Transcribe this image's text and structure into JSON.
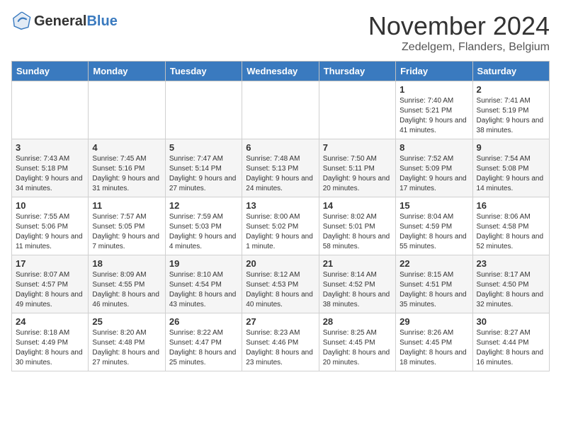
{
  "logo": {
    "text_general": "General",
    "text_blue": "Blue"
  },
  "title": {
    "month_year": "November 2024",
    "location": "Zedelgem, Flanders, Belgium"
  },
  "columns": [
    "Sunday",
    "Monday",
    "Tuesday",
    "Wednesday",
    "Thursday",
    "Friday",
    "Saturday"
  ],
  "weeks": [
    [
      {
        "day": "",
        "sunrise": "",
        "sunset": "",
        "daylight": ""
      },
      {
        "day": "",
        "sunrise": "",
        "sunset": "",
        "daylight": ""
      },
      {
        "day": "",
        "sunrise": "",
        "sunset": "",
        "daylight": ""
      },
      {
        "day": "",
        "sunrise": "",
        "sunset": "",
        "daylight": ""
      },
      {
        "day": "",
        "sunrise": "",
        "sunset": "",
        "daylight": ""
      },
      {
        "day": "1",
        "sunrise": "Sunrise: 7:40 AM",
        "sunset": "Sunset: 5:21 PM",
        "daylight": "Daylight: 9 hours and 41 minutes."
      },
      {
        "day": "2",
        "sunrise": "Sunrise: 7:41 AM",
        "sunset": "Sunset: 5:19 PM",
        "daylight": "Daylight: 9 hours and 38 minutes."
      }
    ],
    [
      {
        "day": "3",
        "sunrise": "Sunrise: 7:43 AM",
        "sunset": "Sunset: 5:18 PM",
        "daylight": "Daylight: 9 hours and 34 minutes."
      },
      {
        "day": "4",
        "sunrise": "Sunrise: 7:45 AM",
        "sunset": "Sunset: 5:16 PM",
        "daylight": "Daylight: 9 hours and 31 minutes."
      },
      {
        "day": "5",
        "sunrise": "Sunrise: 7:47 AM",
        "sunset": "Sunset: 5:14 PM",
        "daylight": "Daylight: 9 hours and 27 minutes."
      },
      {
        "day": "6",
        "sunrise": "Sunrise: 7:48 AM",
        "sunset": "Sunset: 5:13 PM",
        "daylight": "Daylight: 9 hours and 24 minutes."
      },
      {
        "day": "7",
        "sunrise": "Sunrise: 7:50 AM",
        "sunset": "Sunset: 5:11 PM",
        "daylight": "Daylight: 9 hours and 20 minutes."
      },
      {
        "day": "8",
        "sunrise": "Sunrise: 7:52 AM",
        "sunset": "Sunset: 5:09 PM",
        "daylight": "Daylight: 9 hours and 17 minutes."
      },
      {
        "day": "9",
        "sunrise": "Sunrise: 7:54 AM",
        "sunset": "Sunset: 5:08 PM",
        "daylight": "Daylight: 9 hours and 14 minutes."
      }
    ],
    [
      {
        "day": "10",
        "sunrise": "Sunrise: 7:55 AM",
        "sunset": "Sunset: 5:06 PM",
        "daylight": "Daylight: 9 hours and 11 minutes."
      },
      {
        "day": "11",
        "sunrise": "Sunrise: 7:57 AM",
        "sunset": "Sunset: 5:05 PM",
        "daylight": "Daylight: 9 hours and 7 minutes."
      },
      {
        "day": "12",
        "sunrise": "Sunrise: 7:59 AM",
        "sunset": "Sunset: 5:03 PM",
        "daylight": "Daylight: 9 hours and 4 minutes."
      },
      {
        "day": "13",
        "sunrise": "Sunrise: 8:00 AM",
        "sunset": "Sunset: 5:02 PM",
        "daylight": "Daylight: 9 hours and 1 minute."
      },
      {
        "day": "14",
        "sunrise": "Sunrise: 8:02 AM",
        "sunset": "Sunset: 5:01 PM",
        "daylight": "Daylight: 8 hours and 58 minutes."
      },
      {
        "day": "15",
        "sunrise": "Sunrise: 8:04 AM",
        "sunset": "Sunset: 4:59 PM",
        "daylight": "Daylight: 8 hours and 55 minutes."
      },
      {
        "day": "16",
        "sunrise": "Sunrise: 8:06 AM",
        "sunset": "Sunset: 4:58 PM",
        "daylight": "Daylight: 8 hours and 52 minutes."
      }
    ],
    [
      {
        "day": "17",
        "sunrise": "Sunrise: 8:07 AM",
        "sunset": "Sunset: 4:57 PM",
        "daylight": "Daylight: 8 hours and 49 minutes."
      },
      {
        "day": "18",
        "sunrise": "Sunrise: 8:09 AM",
        "sunset": "Sunset: 4:55 PM",
        "daylight": "Daylight: 8 hours and 46 minutes."
      },
      {
        "day": "19",
        "sunrise": "Sunrise: 8:10 AM",
        "sunset": "Sunset: 4:54 PM",
        "daylight": "Daylight: 8 hours and 43 minutes."
      },
      {
        "day": "20",
        "sunrise": "Sunrise: 8:12 AM",
        "sunset": "Sunset: 4:53 PM",
        "daylight": "Daylight: 8 hours and 40 minutes."
      },
      {
        "day": "21",
        "sunrise": "Sunrise: 8:14 AM",
        "sunset": "Sunset: 4:52 PM",
        "daylight": "Daylight: 8 hours and 38 minutes."
      },
      {
        "day": "22",
        "sunrise": "Sunrise: 8:15 AM",
        "sunset": "Sunset: 4:51 PM",
        "daylight": "Daylight: 8 hours and 35 minutes."
      },
      {
        "day": "23",
        "sunrise": "Sunrise: 8:17 AM",
        "sunset": "Sunset: 4:50 PM",
        "daylight": "Daylight: 8 hours and 32 minutes."
      }
    ],
    [
      {
        "day": "24",
        "sunrise": "Sunrise: 8:18 AM",
        "sunset": "Sunset: 4:49 PM",
        "daylight": "Daylight: 8 hours and 30 minutes."
      },
      {
        "day": "25",
        "sunrise": "Sunrise: 8:20 AM",
        "sunset": "Sunset: 4:48 PM",
        "daylight": "Daylight: 8 hours and 27 minutes."
      },
      {
        "day": "26",
        "sunrise": "Sunrise: 8:22 AM",
        "sunset": "Sunset: 4:47 PM",
        "daylight": "Daylight: 8 hours and 25 minutes."
      },
      {
        "day": "27",
        "sunrise": "Sunrise: 8:23 AM",
        "sunset": "Sunset: 4:46 PM",
        "daylight": "Daylight: 8 hours and 23 minutes."
      },
      {
        "day": "28",
        "sunrise": "Sunrise: 8:25 AM",
        "sunset": "Sunset: 4:45 PM",
        "daylight": "Daylight: 8 hours and 20 minutes."
      },
      {
        "day": "29",
        "sunrise": "Sunrise: 8:26 AM",
        "sunset": "Sunset: 4:45 PM",
        "daylight": "Daylight: 8 hours and 18 minutes."
      },
      {
        "day": "30",
        "sunrise": "Sunrise: 8:27 AM",
        "sunset": "Sunset: 4:44 PM",
        "daylight": "Daylight: 8 hours and 16 minutes."
      }
    ]
  ]
}
